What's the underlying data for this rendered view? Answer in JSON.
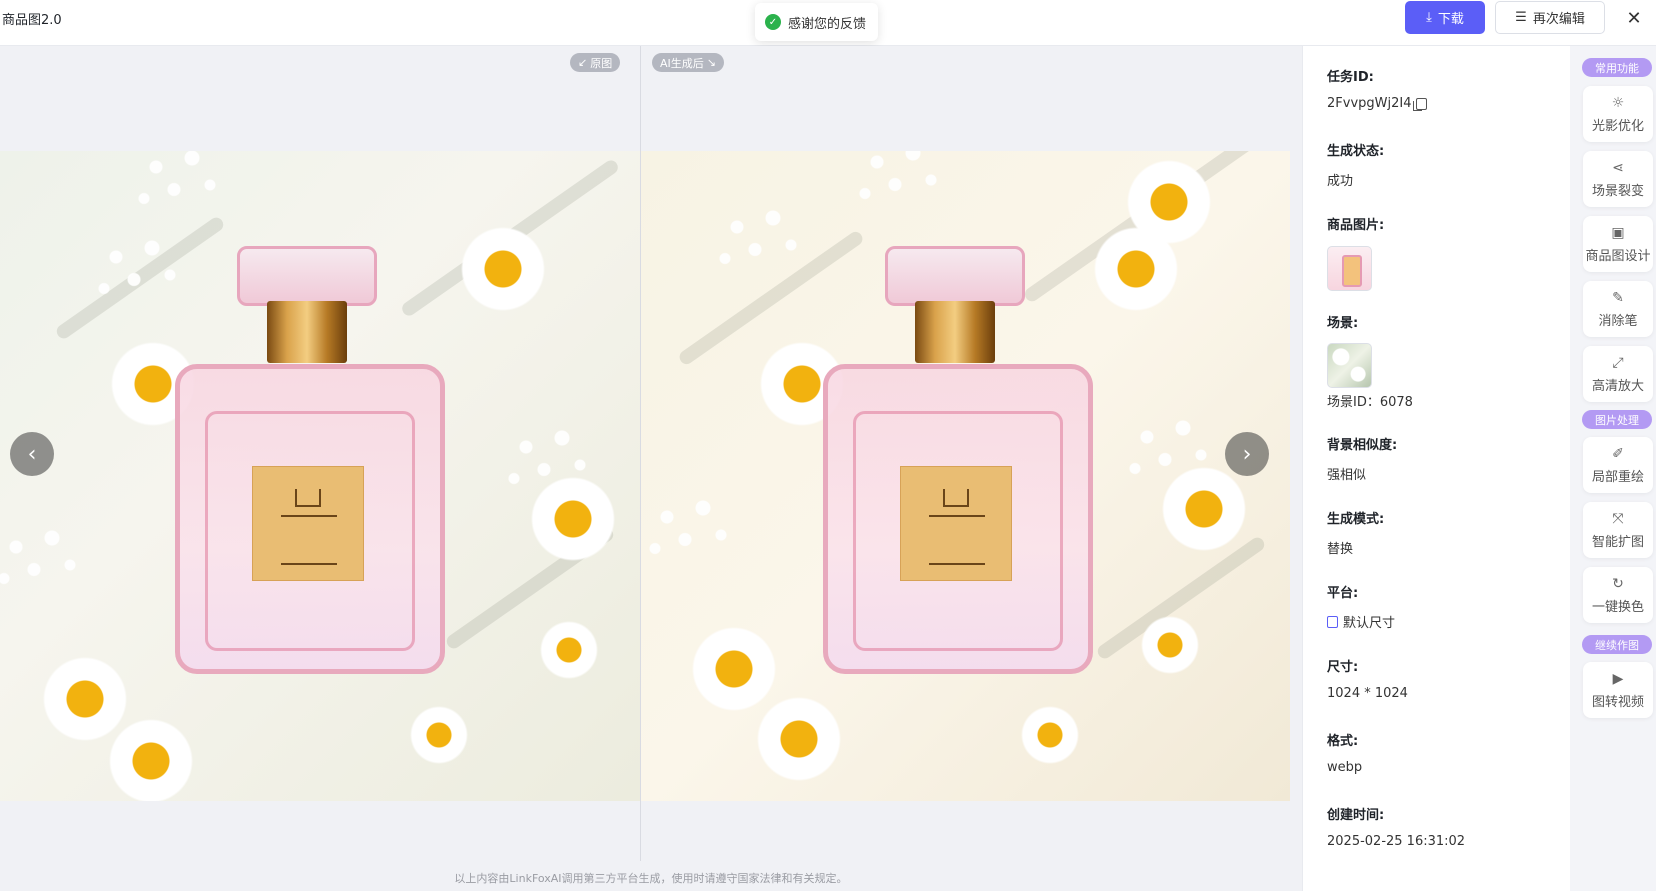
{
  "header": {
    "title": "商品图2.0",
    "toast": "感谢您的反馈",
    "download_label": "下载",
    "reedit_label": "再次编辑"
  },
  "compare": {
    "original_tag": "原图",
    "ai_tag": "AI生成后",
    "disclaimer": "以上内容由LinkFoxAI调用第三方平台生成，使用时请遵守国家法律和有关规定。"
  },
  "info": {
    "task_id_label": "任务ID:",
    "task_id": "2FvvpgWj2I4",
    "status_label": "生成状态:",
    "status": "成功",
    "product_image_label": "商品图片:",
    "scene_label": "场景:",
    "scene_id": "场景ID：6078",
    "bg_similarity_label": "背景相似度:",
    "bg_similarity": "强相似",
    "mode_label": "生成模式:",
    "mode": "替换",
    "platform_label": "平台:",
    "platform": "默认尺寸",
    "size_label": "尺寸:",
    "size": "1024 * 1024",
    "format_label": "格式:",
    "format": "webp",
    "created_label": "创建时间:",
    "created": "2025-02-25 16:31:02"
  },
  "tools": {
    "section_common": "常用功能",
    "section_image": "图片处理",
    "section_continue": "继续作图",
    "items": [
      {
        "label": "光影优化",
        "icon": "sun-icon"
      },
      {
        "label": "场景裂变",
        "icon": "share-icon"
      },
      {
        "label": "商品图设计",
        "icon": "layout-icon"
      },
      {
        "label": "消除笔",
        "icon": "eraser-icon"
      },
      {
        "label": "高清放大",
        "icon": "expand-icon"
      },
      {
        "label": "局部重绘",
        "icon": "edit-icon"
      },
      {
        "label": "智能扩图",
        "icon": "outpaint-icon"
      },
      {
        "label": "一键换色",
        "icon": "recolor-icon"
      },
      {
        "label": "图转视频",
        "icon": "video-icon"
      }
    ]
  },
  "colors": {
    "accent": "#5b5ef7",
    "section_pill": "#b39af3",
    "success": "#2bb24c"
  }
}
